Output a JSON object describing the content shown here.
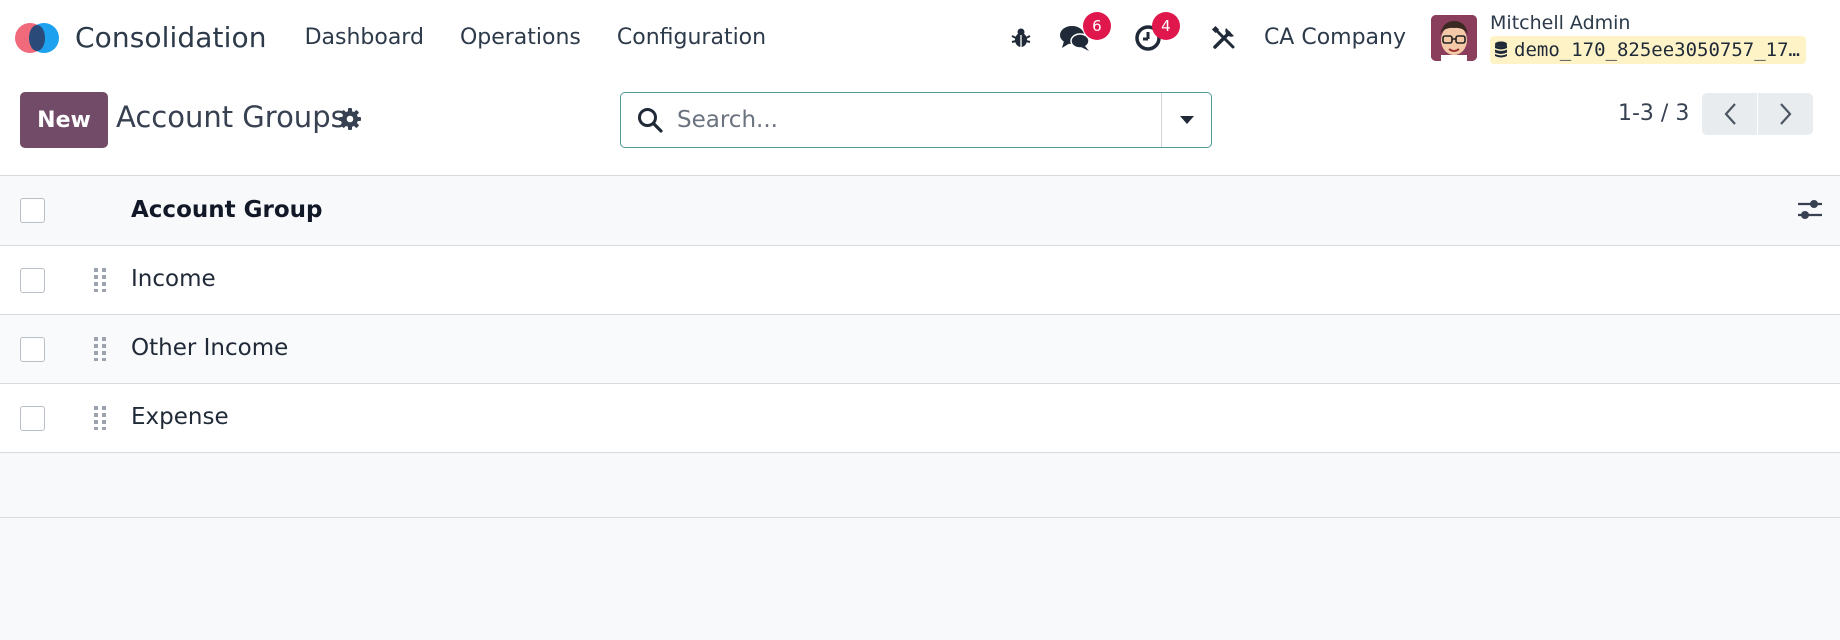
{
  "navbar": {
    "app_name": "Consolidation",
    "menu": [
      "Dashboard",
      "Operations",
      "Configuration"
    ],
    "messages_count": "6",
    "activities_count": "4",
    "company": "CA Company",
    "user_name": "Mitchell Admin",
    "database": "demo_170_825ee3050757_17…"
  },
  "control_panel": {
    "new_label": "New",
    "title": "Account Groups",
    "search_placeholder": "Search...",
    "pager": "1-3 / 3"
  },
  "list": {
    "column_header": "Account Group",
    "rows": [
      "Income",
      "Other Income",
      "Expense"
    ]
  },
  "colors": {
    "primary": "#714b67",
    "badge": "#e0174d",
    "search_border": "#4d9c9c"
  }
}
